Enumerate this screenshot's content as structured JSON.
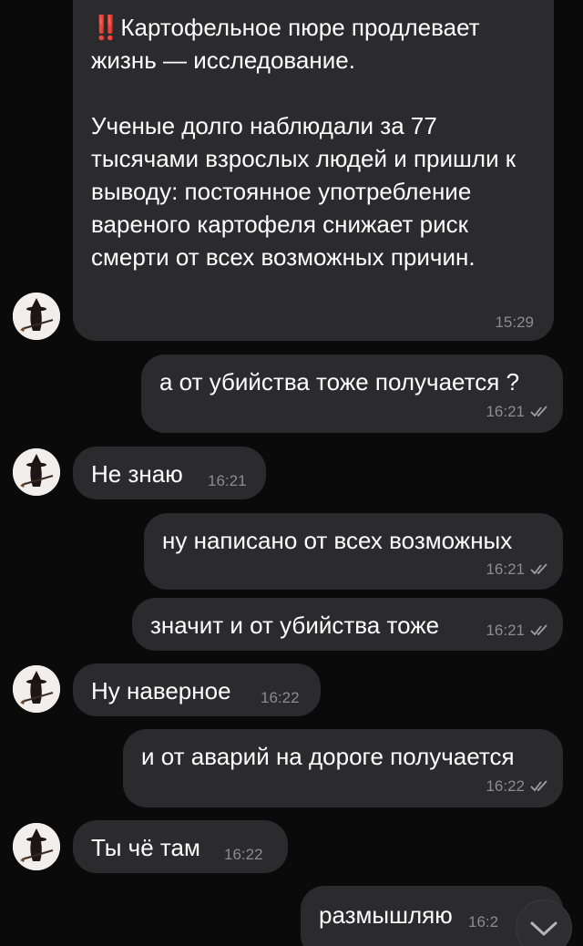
{
  "messages": [
    {
      "id": "m1",
      "direction": "incoming",
      "emoji": "‼️",
      "text": "Картофельное пюре продлевает жизнь — исследование.\n\nУченые долго наблюдали за 77 тысячами взрослых людей и пришли к выводу: постоянное употребление вареного картофеля снижает риск смерти от всех возможных причин.",
      "time": "15:29"
    },
    {
      "id": "m2",
      "direction": "outgoing",
      "text": "а от убийства тоже получается ?",
      "time": "16:21"
    },
    {
      "id": "m3",
      "direction": "incoming",
      "text": "Не знаю",
      "time": "16:21"
    },
    {
      "id": "m4",
      "direction": "outgoing",
      "text": "ну написано от всех возможных",
      "time": "16:21"
    },
    {
      "id": "m5",
      "direction": "outgoing",
      "text": "значит и от убийства тоже",
      "time": "16:21"
    },
    {
      "id": "m6",
      "direction": "incoming",
      "text": "Ну наверное",
      "time": "16:22"
    },
    {
      "id": "m7",
      "direction": "outgoing",
      "text": "и от аварий на дороге получается",
      "time": "16:22"
    },
    {
      "id": "m8",
      "direction": "incoming",
      "text": "Ты чё там",
      "time": "16:22"
    },
    {
      "id": "m9",
      "direction": "outgoing",
      "text": "размышляю",
      "time": "16:2"
    }
  ],
  "icons": {
    "read_receipt": "double-check-icon",
    "scroll_down": "chevron-down-icon",
    "avatar": "witch-avatar"
  },
  "colors": {
    "background": "#0a0a0a",
    "bubble": "#2b2b2d",
    "text": "#ffffff",
    "time": "#8c8c8e"
  }
}
